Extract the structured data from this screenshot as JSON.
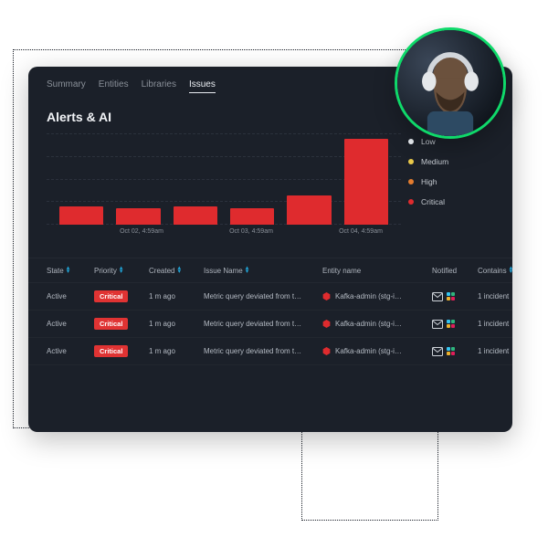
{
  "tabs": [
    {
      "label": "Summary",
      "active": false
    },
    {
      "label": "Entities",
      "active": false
    },
    {
      "label": "Libraries",
      "active": false
    },
    {
      "label": "Issues",
      "active": true
    }
  ],
  "page_title": "Alerts & AI",
  "legend": [
    {
      "label": "Low",
      "color": "#e9edf2"
    },
    {
      "label": "Medium",
      "color": "#e9c84a"
    },
    {
      "label": "High",
      "color": "#e37c2f"
    },
    {
      "label": "Critical",
      "color": "#df2b2e"
    }
  ],
  "columns": [
    {
      "label": "State",
      "sortable": true
    },
    {
      "label": "Priority",
      "sortable": true
    },
    {
      "label": "Created",
      "sortable": true
    },
    {
      "label": "Issue  Name",
      "sortable": true
    },
    {
      "label": "Entity name",
      "sortable": false
    },
    {
      "label": "Notified",
      "sortable": false
    },
    {
      "label": "Contains",
      "sortable": true
    }
  ],
  "rows": [
    {
      "state": "Active",
      "priority": "Critical",
      "created": "1 m ago",
      "issue": "Metric query deviated from t…",
      "entity": "Kafka-admin (stg-i…",
      "contains": "1 incident"
    },
    {
      "state": "Active",
      "priority": "Critical",
      "created": "1 m ago",
      "issue": "Metric query deviated from t…",
      "entity": "Kafka-admin (stg-i…",
      "contains": "1 incident"
    },
    {
      "state": "Active",
      "priority": "Critical",
      "created": "1 m ago",
      "issue": "Metric query deviated from t…",
      "entity": "Kafka-admin (stg-i…",
      "contains": "1 incident"
    }
  ],
  "chart_data": {
    "type": "bar",
    "title": "",
    "xlabel": "",
    "ylabel": "",
    "ylim": [
      0,
      100
    ],
    "categories": [
      "",
      "Oct 02, 4:59am",
      "",
      "Oct 03, 4:59am",
      "",
      "Oct 04, 4:59am"
    ],
    "series": [
      {
        "name": "Critical",
        "color": "#df2b2e",
        "values": [
          20,
          18,
          20,
          18,
          32,
          94
        ]
      }
    ],
    "gridlines": 5
  },
  "colors": {
    "card_bg": "#1b2029",
    "accent_ring": "#0fd96a",
    "critical": "#df2b2e",
    "sort_accent": "#20a7db"
  }
}
